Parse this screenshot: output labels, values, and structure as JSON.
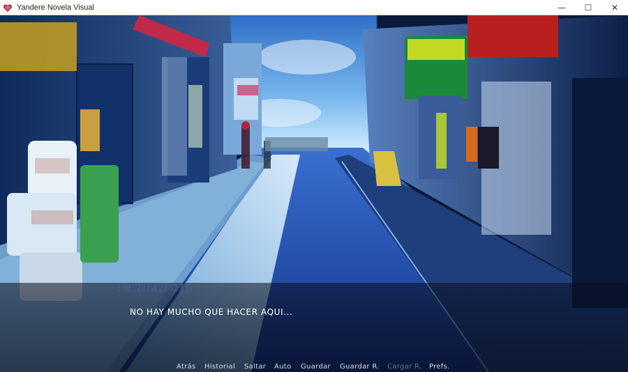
{
  "window": {
    "title": "Yandere Novela Visual",
    "icon": "heart-app-icon",
    "controls": {
      "minimize": "—",
      "maximize": "☐",
      "close": "✕"
    }
  },
  "dialogue": {
    "speaker": "NARRADOR",
    "text": "NO HAY MUCHO QUE HACER AQUI..."
  },
  "quick_menu": [
    {
      "label": "Atrás",
      "enabled": true
    },
    {
      "label": "Historial",
      "enabled": true
    },
    {
      "label": "Saltar",
      "enabled": true
    },
    {
      "label": "Auto",
      "enabled": true
    },
    {
      "label": "Guardar",
      "enabled": true
    },
    {
      "label": "Guardar R.",
      "enabled": true
    },
    {
      "label": "Cargar R.",
      "enabled": false
    },
    {
      "label": "Prefs.",
      "enabled": true
    }
  ],
  "colors": {
    "sky": "#4a8fd8",
    "street": "#1d4fb0",
    "sidewalk_glow": "#bfe8ff",
    "speaker": "#3a4c7a",
    "menu_text": "#d8dde8",
    "menu_disabled": "#6c7388"
  }
}
